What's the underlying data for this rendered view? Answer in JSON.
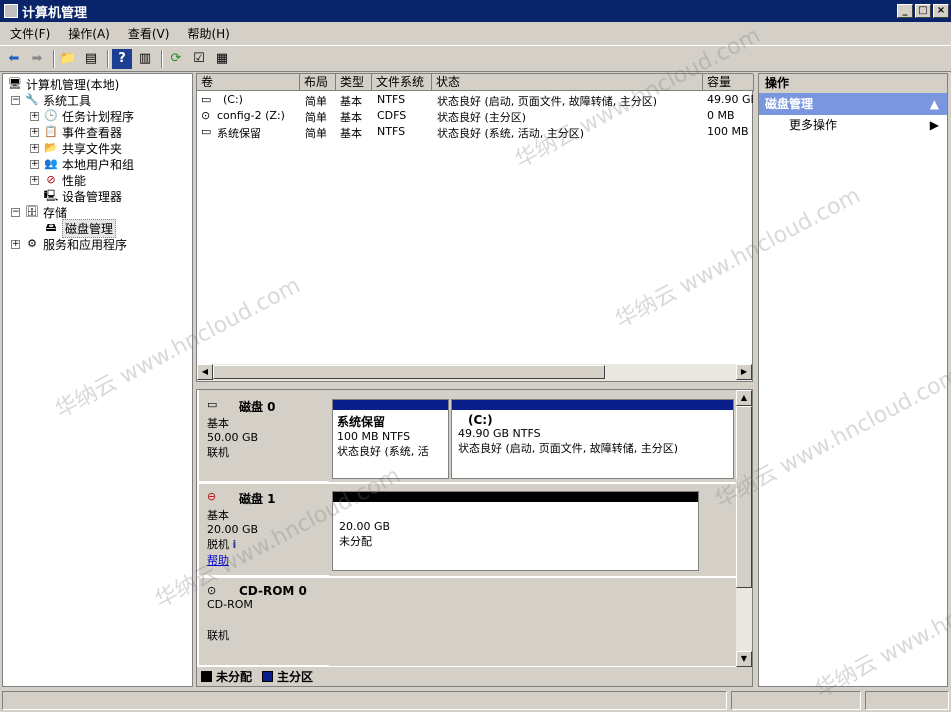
{
  "window": {
    "title": "计算机管理"
  },
  "menu": [
    "文件(F)",
    "操作(A)",
    "查看(V)",
    "帮助(H)"
  ],
  "tree": {
    "root": "计算机管理(本地)",
    "items": [
      {
        "label": "系统工具",
        "level": 1,
        "expander": "⊟"
      },
      {
        "label": "任务计划程序",
        "level": 2,
        "expander": "⊞"
      },
      {
        "label": "事件查看器",
        "level": 2,
        "expander": "⊞"
      },
      {
        "label": "共享文件夹",
        "level": 2,
        "expander": "⊞"
      },
      {
        "label": "本地用户和组",
        "level": 2,
        "expander": "⊞"
      },
      {
        "label": "性能",
        "level": 2,
        "expander": "⊞"
      },
      {
        "label": "设备管理器",
        "level": 2,
        "expander": ""
      },
      {
        "label": "存储",
        "level": 1,
        "expander": "⊟"
      },
      {
        "label": "磁盘管理",
        "level": 2,
        "expander": "",
        "selected": true
      },
      {
        "label": "服务和应用程序",
        "level": 1,
        "expander": "⊞"
      }
    ]
  },
  "volumes": {
    "headers": [
      "卷",
      "布局",
      "类型",
      "文件系统",
      "状态",
      "容量"
    ],
    "rows": [
      [
        "(C:)",
        "简单",
        "基本",
        "NTFS",
        "状态良好 (启动, 页面文件, 故障转储, 主分区)",
        "49.90 GB"
      ],
      [
        "config-2 (Z:)",
        "简单",
        "基本",
        "CDFS",
        "状态良好 (主分区)",
        "0 MB"
      ],
      [
        "系统保留",
        "简单",
        "基本",
        "NTFS",
        "状态良好 (系统, 活动, 主分区)",
        "100 MB"
      ]
    ]
  },
  "disks": [
    {
      "name": "磁盘 0",
      "type": "基本",
      "size": "50.00 GB",
      "status": "联机",
      "partitions": [
        {
          "name": "系统保留",
          "size": "100 MB NTFS",
          "status": "状态良好 (系统, 活"
        },
        {
          "name": "(C:)",
          "size": "49.90 GB NTFS",
          "status": "状态良好 (启动, 页面文件, 故障转储, 主分区)"
        }
      ]
    },
    {
      "name": "磁盘 1",
      "type": "基本",
      "size": "20.00 GB",
      "status": "脱机",
      "help": "帮助",
      "partitions": [
        {
          "size": "20.00 GB",
          "status": "未分配"
        }
      ]
    },
    {
      "name": "CD-ROM 0",
      "type": "CD-ROM",
      "status": "联机"
    }
  ],
  "legend": [
    {
      "label": "未分配",
      "color": "#000000"
    },
    {
      "label": "主分区",
      "color": "#0a1e8c"
    }
  ],
  "actions": {
    "header": "操作",
    "section": "磁盘管理",
    "items": [
      "更多操作"
    ]
  },
  "watermark": [
    "华纳云 www.hncloud.com"
  ]
}
